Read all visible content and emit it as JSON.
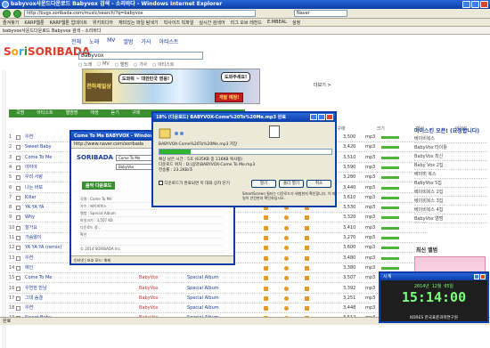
{
  "browser": {
    "title": "babyvox사운드다운로드 Babyvox 검색 - 소리바다 - Windows Internet Explorer",
    "address": "http://bugs.soribada.com/music/search/?q=babyvox",
    "search_placeholder": "Naver",
    "links_bar": [
      "즐겨찾기",
      "KARP웹툰",
      "KARP웹툰 업데이트",
      "위키피디아",
      "재미있는 파일 탐색기",
      "빅사이즈 빅파일",
      "실시간 검색어",
      "리그 오브 레전드",
      "E:MBEAL",
      "설정"
    ],
    "toolbar3": [
      "babyvox사운드다운로드 Babyvox 검색 - 소리바다"
    ],
    "status_text": "완료"
  },
  "site": {
    "logo": "SORIBADA",
    "topnav": [
      "전체",
      "노래",
      "MV",
      "앨범",
      "가사",
      "아티스트"
    ],
    "search_value": "babyvox",
    "search_tabs": [
      "노래",
      "MV",
      "앨범",
      "가사",
      "아티스트"
    ],
    "banner": {
      "game_logo": "천하제일상",
      "bubble_left": "도와줘 ~ 대한민국 영웅!",
      "bubble_right": "도와주세요!",
      "start_label": "개발 예정!"
    },
    "side_note": "더보기 >",
    "menu": [
      "곡명",
      "아티스트",
      "앨범명",
      "재생",
      "듣기",
      "구매"
    ],
    "columns": [
      "듣기",
      "담기",
      "구매",
      "크기",
      "형식",
      "인기도"
    ]
  },
  "rows": [
    {
      "n": "1",
      "title": "우연",
      "artist": "",
      "album": "",
      "size": "3,500",
      "fmt": "mp3"
    },
    {
      "n": "2",
      "title": "Sweet Baby",
      "artist": "",
      "album": "",
      "size": "3,420",
      "fmt": "mp3"
    },
    {
      "n": "3",
      "title": "Come To Me",
      "artist": "",
      "album": "",
      "size": "3,510",
      "fmt": "mp3"
    },
    {
      "n": "4",
      "title": "야야야",
      "artist": "",
      "album": "",
      "size": "3,590",
      "fmt": "mp3"
    },
    {
      "n": "5",
      "title": "우리 사랑",
      "artist": "",
      "album": "",
      "size": "3,280",
      "fmt": "mp3"
    },
    {
      "n": "6",
      "title": "나는 바보",
      "artist": "",
      "album": "",
      "size": "3,440",
      "fmt": "mp3"
    },
    {
      "n": "7",
      "title": "Killer",
      "artist": "",
      "album": "",
      "size": "3,610",
      "fmt": "mp3"
    },
    {
      "n": "8",
      "title": "YA YA YA",
      "artist": "",
      "album": "",
      "size": "3,530",
      "fmt": "mp3"
    },
    {
      "n": "9",
      "title": "Why",
      "artist": "",
      "album": "",
      "size": "3,320",
      "fmt": "mp3"
    },
    {
      "n": "10",
      "title": "잘가요",
      "artist": "",
      "album": "",
      "size": "3,410",
      "fmt": "mp3"
    },
    {
      "n": "11",
      "title": "가슴앓이",
      "artist": "",
      "album": "",
      "size": "3,270",
      "fmt": "mp3"
    },
    {
      "n": "12",
      "title": "YA YA YA (remix)",
      "artist": "",
      "album": "",
      "size": "3,600",
      "fmt": "mp3"
    },
    {
      "n": "13",
      "title": "우연",
      "artist": "",
      "album": "",
      "size": "3,480",
      "fmt": "mp3"
    },
    {
      "n": "14",
      "title": "애인",
      "artist": "",
      "album": "",
      "size": "3,380",
      "fmt": "mp3"
    },
    {
      "n": "15",
      "title": "Come To Me",
      "artist": "BabyVox",
      "album": "Special Album",
      "size": "3,507",
      "fmt": "mp3"
    },
    {
      "n": "16",
      "title": "우연한 만남",
      "artist": "BabyVox",
      "album": "Special Album",
      "size": "3,392",
      "fmt": "mp3"
    },
    {
      "n": "17",
      "title": "그대 숨결",
      "artist": "BabyVox",
      "album": "Special Album",
      "size": "3,251",
      "fmt": "mp3"
    },
    {
      "n": "18",
      "title": "우연",
      "artist": "BabyVox",
      "album": "Special Album",
      "size": "3,448",
      "fmt": "mp3"
    },
    {
      "n": "19",
      "title": "Sweet Baby",
      "artist": "BabyVox",
      "album": "Special Album",
      "size": "3,512",
      "fmt": "mp3"
    }
  ],
  "right_pane": {
    "title": "마이스킨 오픈! (요청합니다)",
    "items": [
      "베이비복스",
      "BabyVox 타이틀",
      "BabyVox 최신",
      "Baby Vox 2집",
      "베이비 복스",
      "BabyVox 5집",
      "베이비복스 2집",
      "베이비복스 3집",
      "베이비복스 4집",
      "BabyVox 앨범"
    ],
    "new_album": "최신 앨범"
  },
  "popup": {
    "title": "Come To Me BABYVOX - Windows Internet Explorer",
    "address": "http://www.naver.com/soribada",
    "logo": "SORIBADA",
    "input1": "Come To Me",
    "input2": "BabyVox",
    "button": "음악 다운로드",
    "lines": [
      "곡명 : Come To Me",
      "가수 : 베이비복스",
      "앨범 : Special Album",
      "파일크기 : 3,507 KB",
      "다운로드 중...",
      "확인",
      "",
      "© 2014 SORIBADA Inc."
    ],
    "status": "인터넷 | 보호 모드: 해제"
  },
  "dialog": {
    "title": "18% (다운로드) BABYVOX-Come%20To%20Me.mp3 완료",
    "line1": "BABYVOX-Come%20To%20Me.mp3 저장",
    "progress": 0.18,
    "info": [
      "예상 남은 시간 :  5초 (635KB 중 116KB 복사됨)",
      "다운로드 위치 :  D:\\음악\\BABYVOX-Come To Me.mp3",
      "전송률 :  23.2KB/초"
    ],
    "checkbox": "다운로드가 완료되면 이 대화 상자 닫기",
    "buttons": [
      "열기",
      "폴더 열기",
      "취소"
    ],
    "note": "SmartScreen 필터는 다운로드가 위험한지 확인합니다. 이 파일이 안전한지 확인하십시오."
  },
  "clock": {
    "title": "시계",
    "date": "2014년 12월 05일",
    "time": "15:14:00",
    "footer": "KORES 한국표준과학연구원"
  },
  "colors": {
    "accent": "#3a8f2e",
    "titlebar": "#0a3ea8",
    "link": "#1a3aa0"
  }
}
